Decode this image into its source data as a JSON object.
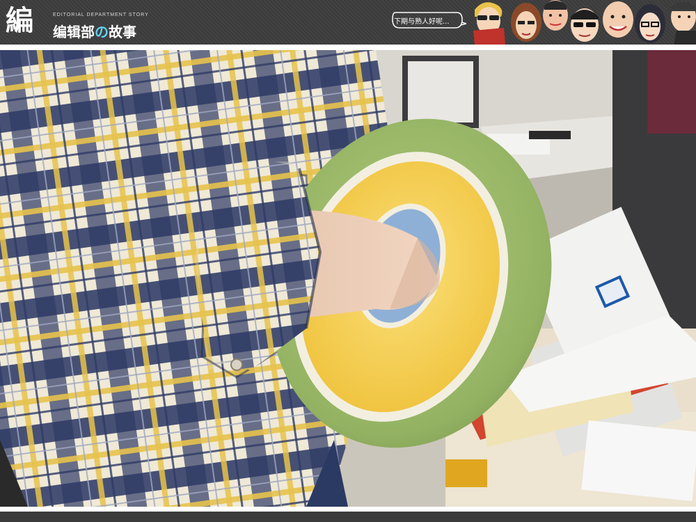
{
  "header": {
    "logo_mark": "編",
    "subtitle": "EDITORIAL DEPARTMENT STORY",
    "title_part1": "编辑部",
    "title_no": "の",
    "title_part2": "故事",
    "bubble_text": "下期与熟人好呢..."
  },
  "photo": {
    "subject": "hand-warmer-plush",
    "colors": {
      "plaid_navy": "#2f3b66",
      "plaid_cream": "#efe9d6",
      "plaid_yellow": "#e7c24d",
      "plush_green": "#9dbb6a",
      "plush_yellow": "#f5cf4a",
      "plush_trim": "#f3efe0",
      "desk": "#e9dfcc"
    }
  }
}
